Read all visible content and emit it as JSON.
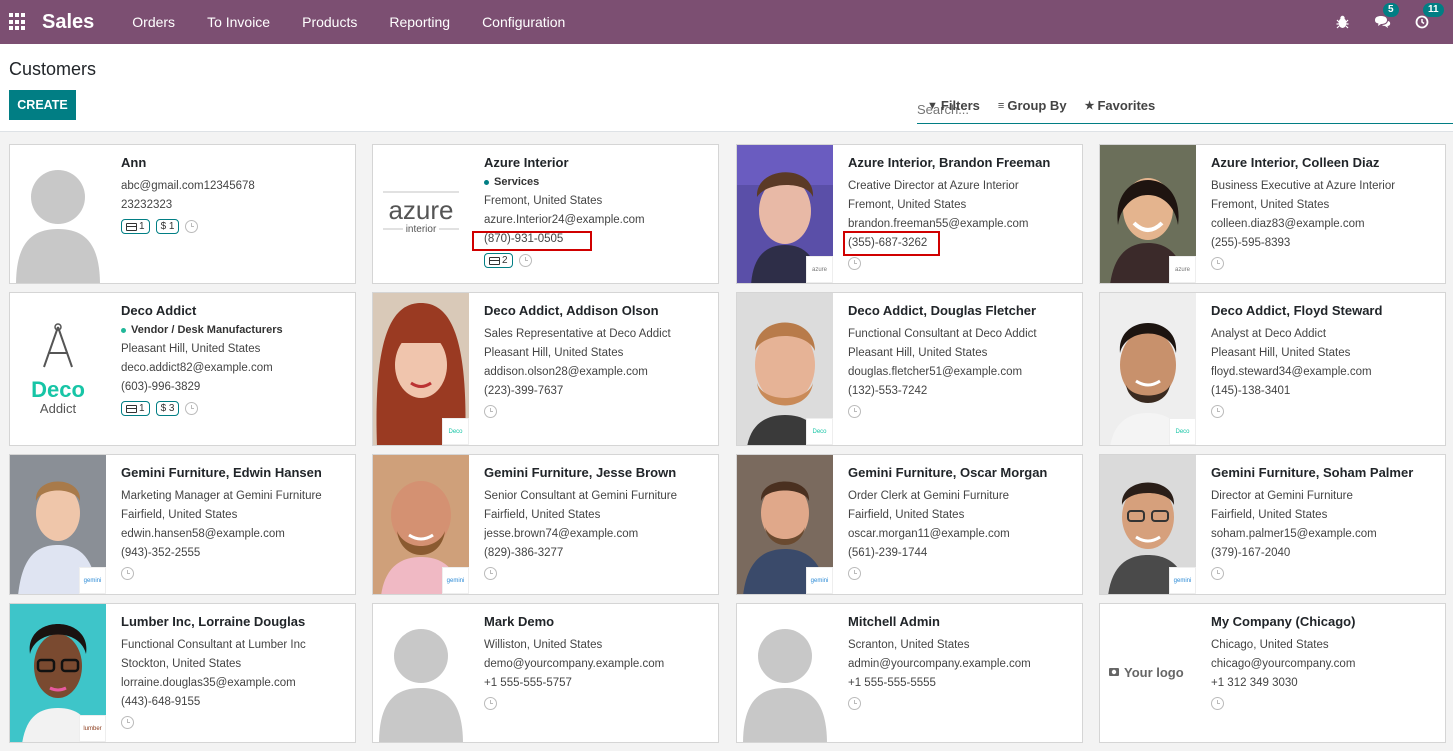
{
  "app": {
    "brand": "Sales",
    "menu": [
      "Orders",
      "To Invoice",
      "Products",
      "Reporting",
      "Configuration"
    ],
    "systray": {
      "messages_count": "5",
      "activities_count": "11"
    }
  },
  "control_panel": {
    "title": "Customers",
    "create_label": "CREATE",
    "search_placeholder": "Search...",
    "filters_label": "Filters",
    "groupby_label": "Group By",
    "favorites_label": "Favorites"
  },
  "cards": [
    {
      "name": "Ann",
      "lines": [
        "abc@gmail.com12345678",
        "23232323"
      ],
      "badges": [
        "1",
        "$ 1"
      ],
      "photo": "placeholder"
    },
    {
      "name": "Azure Interior",
      "tag": "Services",
      "lines": [
        "Fremont, United States",
        "azure.Interior24@example.com",
        "(870)-931-0505"
      ],
      "badges": [
        "2"
      ],
      "photo": "azure-logo",
      "logo_text": "azure",
      "logo_sub": "interior"
    },
    {
      "name": "Azure Interior, Brandon Freeman",
      "lines": [
        "Creative Director at Azure Interior",
        "Fremont, United States",
        "brandon.freeman55@example.com",
        "(355)-687-3262"
      ],
      "photo": "person",
      "mini": "azure"
    },
    {
      "name": "Azure Interior, Colleen Diaz",
      "lines": [
        "Business Executive at Azure Interior",
        "Fremont, United States",
        "colleen.diaz83@example.com",
        "(255)-595-8393"
      ],
      "photo": "person",
      "mini": "azure"
    },
    {
      "name": "Deco Addict",
      "tag": "Vendor / Desk Manufacturers",
      "lines": [
        "Pleasant Hill, United States",
        "deco.addict82@example.com",
        "(603)-996-3829"
      ],
      "badges": [
        "1",
        "$ 3"
      ],
      "photo": "deco-logo",
      "logo_text": "Deco",
      "logo_sub": "Addict"
    },
    {
      "name": "Deco Addict, Addison Olson",
      "lines": [
        "Sales Representative at Deco Addict",
        "Pleasant Hill, United States",
        "addison.olson28@example.com",
        "(223)-399-7637"
      ],
      "photo": "person",
      "mini": "Deco"
    },
    {
      "name": "Deco Addict, Douglas Fletcher",
      "lines": [
        "Functional Consultant at Deco Addict",
        "Pleasant Hill, United States",
        "douglas.fletcher51@example.com",
        "(132)-553-7242"
      ],
      "photo": "person",
      "mini": "Deco"
    },
    {
      "name": "Deco Addict, Floyd Steward",
      "lines": [
        "Analyst at Deco Addict",
        "Pleasant Hill, United States",
        "floyd.steward34@example.com",
        "(145)-138-3401"
      ],
      "photo": "person",
      "mini": "Deco"
    },
    {
      "name": "Gemini Furniture, Edwin Hansen",
      "lines": [
        "Marketing Manager at Gemini Furniture",
        "Fairfield, United States",
        "edwin.hansen58@example.com",
        "(943)-352-2555"
      ],
      "photo": "person",
      "mini": "gemini"
    },
    {
      "name": "Gemini Furniture, Jesse Brown",
      "lines": [
        "Senior Consultant at Gemini Furniture",
        "Fairfield, United States",
        "jesse.brown74@example.com",
        "(829)-386-3277"
      ],
      "photo": "person",
      "mini": "gemini"
    },
    {
      "name": "Gemini Furniture, Oscar Morgan",
      "lines": [
        "Order Clerk at Gemini Furniture",
        "Fairfield, United States",
        "oscar.morgan11@example.com",
        "(561)-239-1744"
      ],
      "photo": "person",
      "mini": "gemini"
    },
    {
      "name": "Gemini Furniture, Soham Palmer",
      "lines": [
        "Director at Gemini Furniture",
        "Fairfield, United States",
        "soham.palmer15@example.com",
        "(379)-167-2040"
      ],
      "photo": "person",
      "mini": "gemini"
    },
    {
      "name": "Lumber Inc, Lorraine Douglas",
      "lines": [
        "Functional Consultant at Lumber Inc",
        "Stockton, United States",
        "lorraine.douglas35@example.com",
        "(443)-648-9155"
      ],
      "photo": "person",
      "mini": "lumber"
    },
    {
      "name": "Mark Demo",
      "lines": [
        "Williston, United States",
        "demo@yourcompany.example.com",
        "+1 555-555-5757"
      ],
      "photo": "placeholder"
    },
    {
      "name": "Mitchell Admin",
      "lines": [
        "Scranton, United States",
        "admin@yourcompany.example.com",
        "+1 555-555-5555"
      ],
      "photo": "placeholder"
    },
    {
      "name": "My Company (Chicago)",
      "lines": [
        "Chicago, United States",
        "chicago@yourcompany.com",
        "+1 312 349 3030"
      ],
      "photo": "yourlogo",
      "logo_text": "Your logo"
    }
  ],
  "colors": {
    "brand_bar": "#7c4f72",
    "primary": "#017e84",
    "highlight": "#d00000"
  }
}
